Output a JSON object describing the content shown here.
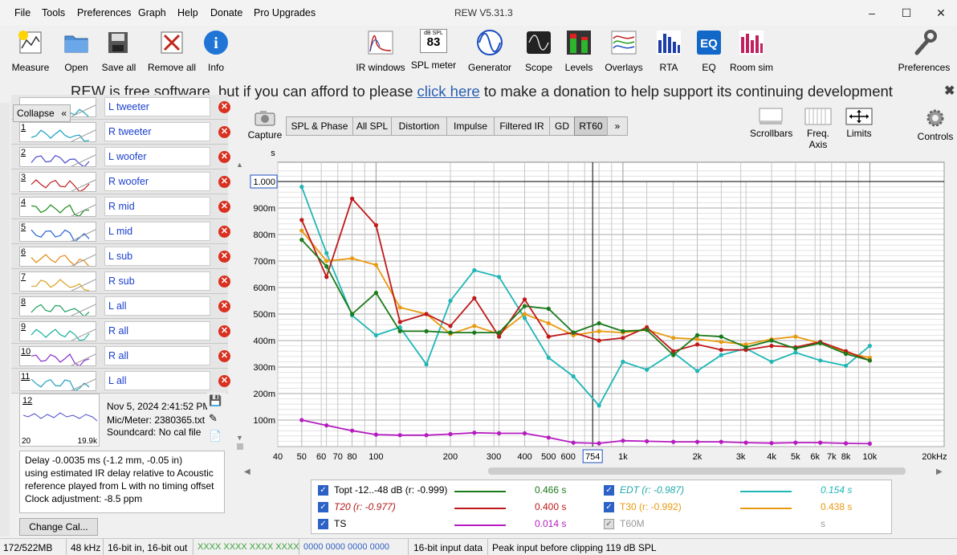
{
  "menu": [
    "File",
    "Tools",
    "Preferences",
    "Graph",
    "Help",
    "Donate",
    "Pro Upgrades"
  ],
  "window_title": "REW V5.31.3",
  "toolbar_left": [
    "Measure",
    "Open",
    "Save all",
    "Remove all",
    "Info"
  ],
  "toolbar_mid": [
    "IR windows",
    "SPL meter",
    "Generator",
    "Scope",
    "Levels",
    "Overlays",
    "RTA",
    "EQ",
    "Room sim"
  ],
  "spl_meter_icon": {
    "top": "dB SPL",
    "value": "83"
  },
  "toolbar_right": [
    "Preferences"
  ],
  "donation": {
    "before": "REW is free software, but if you can afford to please ",
    "link": "click here",
    "after": " to make a donation to help support its continuing development"
  },
  "collapse_label": "Collapse",
  "measurements": [
    {
      "num": "",
      "name": "L tweeter"
    },
    {
      "num": "1",
      "name": "R tweeter"
    },
    {
      "num": "2",
      "name": "L woofer"
    },
    {
      "num": "3",
      "name": "R woofer"
    },
    {
      "num": "4",
      "name": "R mid"
    },
    {
      "num": "5",
      "name": "L mid"
    },
    {
      "num": "6",
      "name": "L sub"
    },
    {
      "num": "7",
      "name": "R sub"
    },
    {
      "num": "8",
      "name": "L all"
    },
    {
      "num": "9",
      "name": "R all"
    },
    {
      "num": "10",
      "name": "R all"
    },
    {
      "num": "11",
      "name": "L all"
    }
  ],
  "selected": {
    "num": "12",
    "thumb_left": "20",
    "thumb_right": "19.9k",
    "date": "Nov 5, 2024 2:41:52 PM",
    "mic": "Mic/Meter: 2380365.txt",
    "soundcard": "Soundcard: No cal file"
  },
  "notes": [
    "Delay -0.0035 ms (-1.2 mm, -0.05 in)",
    "using estimated IR delay relative to Acoustic",
    "reference played from  L with no timing offset",
    "Clock adjustment: -8.5 ppm"
  ],
  "change_cal": "Change Cal...",
  "capture_label": "Capture",
  "graph_tabs": [
    "SPL & Phase",
    "All SPL",
    "Distortion",
    "Impulse",
    "Filtered IR",
    "GD",
    "RT60",
    "»"
  ],
  "active_tab": "RT60",
  "right_tools": [
    "Scrollbars",
    "Freq. Axis",
    "Limits",
    "Controls"
  ],
  "chart_data": {
    "type": "line",
    "ylabel": "s",
    "xlabel": "",
    "x_scale": "log",
    "xlim": [
      40,
      20000
    ],
    "ylim": [
      0,
      1.0
    ],
    "cursor_x": "754",
    "cursor_y": "1.000",
    "x_ticks": [
      "40",
      "50",
      "60",
      "70",
      "80",
      "100",
      "200",
      "300",
      "400",
      "500",
      "600",
      "754",
      "1k",
      "2k",
      "3k",
      "4k",
      "5k",
      "6k",
      "7k",
      "8k",
      "10k",
      "20kHz"
    ],
    "y_ticks": [
      "100m",
      "200m",
      "300m",
      "400m",
      "500m",
      "600m",
      "700m",
      "800m",
      "900m",
      "1.000"
    ],
    "x": [
      50,
      63,
      80,
      100,
      125,
      160,
      200,
      250,
      315,
      400,
      500,
      630,
      800,
      1000,
      1250,
      1600,
      2000,
      2500,
      3150,
      4000,
      5000,
      6300,
      8000,
      10000
    ],
    "series": [
      {
        "name": "Topt -12..-48 dB (r: -0.999)",
        "value": "0.466 s",
        "color": "#1a7a1a",
        "values": [
          0.78,
          0.68,
          0.5,
          0.58,
          0.435,
          0.435,
          0.43,
          0.43,
          0.43,
          0.53,
          0.52,
          0.43,
          0.465,
          0.435,
          0.44,
          0.345,
          0.42,
          0.415,
          0.375,
          0.4,
          0.37,
          0.39,
          0.35,
          0.325
        ]
      },
      {
        "name": "T20 (r: -0.977)",
        "value": "0.400 s",
        "color": "#c01818",
        "values": [
          0.855,
          0.64,
          0.935,
          0.835,
          0.47,
          0.5,
          0.455,
          0.56,
          0.415,
          0.555,
          0.415,
          0.43,
          0.4,
          0.41,
          0.45,
          0.36,
          0.385,
          0.365,
          0.365,
          0.38,
          0.375,
          0.395,
          0.36,
          0.325
        ]
      },
      {
        "name": "TS",
        "value": "0.014 s",
        "color": "#b51bc0",
        "values": [
          0.1,
          0.08,
          0.06,
          0.045,
          0.043,
          0.043,
          0.047,
          0.052,
          0.05,
          0.05,
          0.034,
          0.015,
          0.012,
          0.022,
          0.02,
          0.018,
          0.018,
          0.018,
          0.015,
          0.013,
          0.015,
          0.015,
          0.012,
          0.011
        ]
      },
      {
        "name": "EDT (r: -0.987)",
        "value": "0.154 s",
        "color": "#20b6b6",
        "values": [
          0.98,
          0.73,
          0.495,
          0.42,
          0.45,
          0.31,
          0.55,
          0.665,
          0.64,
          0.485,
          0.335,
          0.265,
          0.155,
          0.32,
          0.29,
          0.355,
          0.285,
          0.345,
          0.37,
          0.32,
          0.355,
          0.325,
          0.305,
          0.38
        ]
      },
      {
        "name": "T30 (r: -0.992)",
        "value": "0.438 s",
        "color": "#e89a10",
        "values": [
          0.815,
          0.7,
          0.71,
          0.685,
          0.525,
          0.5,
          0.425,
          0.455,
          0.425,
          0.5,
          0.465,
          0.42,
          0.435,
          0.43,
          0.44,
          0.41,
          0.405,
          0.395,
          0.385,
          0.405,
          0.415,
          0.39,
          0.355,
          0.335
        ]
      },
      {
        "name": "T60M",
        "value": "s",
        "color": "#999999",
        "values": []
      }
    ]
  },
  "status": [
    "172/522MB",
    "48 kHz",
    "16-bit in, 16-bit out",
    "XXXX XXXX  XXXX XXXX",
    "0000 0000  0000 0000",
    "16-bit input data",
    "Peak input before clipping 119 dB SPL"
  ]
}
